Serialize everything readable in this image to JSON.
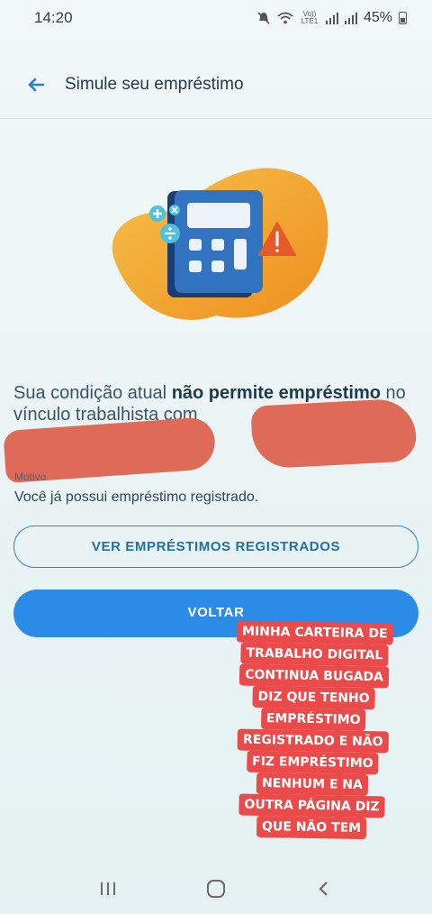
{
  "status_bar": {
    "time": "14:20",
    "network_label": "Vo)) LTE1",
    "battery": "45%"
  },
  "header": {
    "title": "Simule seu empréstimo"
  },
  "condition": {
    "prefix": "Sua condição atual ",
    "highlight": "não permite empréstimo",
    "suffix": " no vínculo trabalhista com"
  },
  "motivo": {
    "label": "Motivo",
    "value": "Você já possui empréstimo registrado."
  },
  "buttons": {
    "view_loans": "VER EMPRÉSTIMOS REGISTRADOS",
    "back": "VOLTAR"
  },
  "sticker": {
    "lines": [
      "MINHA CARTEIRA DE",
      "TRABALHO DIGITAL",
      "CONTINUA BUGADA",
      "DIZ QUE TENHO",
      "EMPRÉSTIMO",
      "REGISTRADO E NÃO",
      "FIZ EMPRÉSTIMO",
      "NENHUM E NA",
      "OUTRA PÁGINA DIZ",
      "QUE NÃO TEM"
    ]
  },
  "colors": {
    "accent": "#2a8ce6",
    "outline": "#2b87c9",
    "illustration_orange": "#f0a52a",
    "calculator_blue": "#2f6fb4",
    "sticker_red": "#ea4a4a",
    "redaction": "#e06a58"
  },
  "icons": {
    "back": "arrow-left-icon",
    "mute": "mute-icon",
    "wifi": "wifi-icon",
    "nav_recent": "recent-apps-icon",
    "nav_home": "home-icon",
    "nav_back": "chevron-left-icon"
  }
}
